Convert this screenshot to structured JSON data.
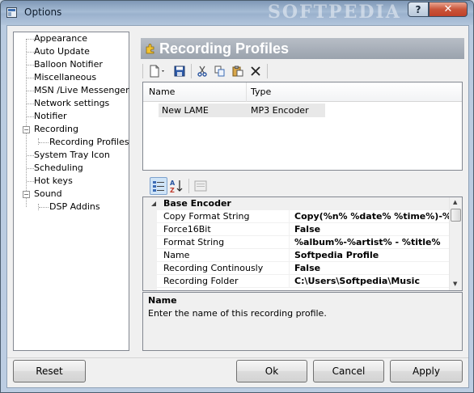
{
  "window": {
    "title": "Options",
    "watermark": "SOFTPEDIA",
    "help_label": "?",
    "close_label": "✕"
  },
  "tree": {
    "items": [
      {
        "label": "Appearance"
      },
      {
        "label": "Auto Update"
      },
      {
        "label": "Balloon Notifier"
      },
      {
        "label": "Miscellaneous"
      },
      {
        "label": "MSN /Live Messenger"
      },
      {
        "label": "Network settings"
      },
      {
        "label": "Notifier"
      },
      {
        "label": "Recording",
        "expanded": true
      },
      {
        "label": "Recording Profiles",
        "child": true
      },
      {
        "label": "System Tray Icon"
      },
      {
        "label": "Scheduling"
      },
      {
        "label": "Hot keys"
      },
      {
        "label": "Sound",
        "expanded": true
      },
      {
        "label": "DSP Addins",
        "child": true
      }
    ],
    "expander_minus": "−"
  },
  "panel": {
    "title": "Recording Profiles"
  },
  "toolbar": {
    "icons": [
      "new-icon",
      "save-icon",
      "cut-icon",
      "copy-icon",
      "paste-icon",
      "delete-icon"
    ]
  },
  "profiles": {
    "columns": [
      "Name",
      "Type"
    ],
    "rows": [
      {
        "name": "New LAME",
        "type": "MP3 Encoder"
      }
    ]
  },
  "property_grid": {
    "category": "Base Encoder",
    "rows": [
      {
        "name": "Copy Format String",
        "value": "Copy(%n% %date% %time%)-%file"
      },
      {
        "name": "Force16Bit",
        "value": "False"
      },
      {
        "name": "Format String",
        "value": "%album%-%artist% - %title%"
      },
      {
        "name": "Name",
        "value": "Softpedia Profile"
      },
      {
        "name": "Recording Continously",
        "value": "False"
      },
      {
        "name": "Recording Folder",
        "value": "C:\\Users\\Softpedia\\Music"
      }
    ],
    "description_title": "Name",
    "description_text": "Enter the name of this recording profile."
  },
  "buttons": {
    "reset": "Reset",
    "ok": "Ok",
    "cancel": "Cancel",
    "apply": "Apply"
  }
}
